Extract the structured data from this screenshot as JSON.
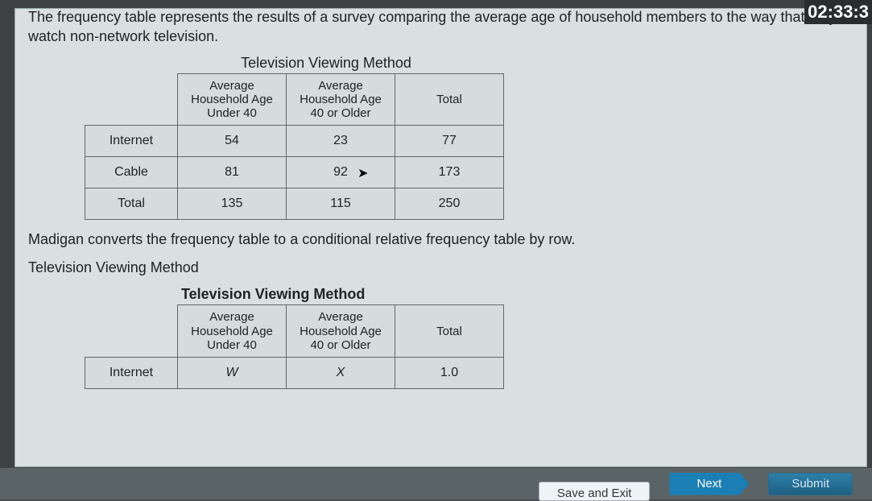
{
  "timer": "02:33:3",
  "intro": "The frequency table represents the results of a survey comparing the average age of household members to the way that they watch non-network television.",
  "table1": {
    "title": "Television Viewing Method",
    "col_headers": [
      "Average Household Age Under 40",
      "Average Household Age 40 or Older",
      "Total"
    ],
    "rows": [
      {
        "label": "Internet",
        "cells": [
          "54",
          "23",
          "77"
        ]
      },
      {
        "label": "Cable",
        "cells": [
          "81",
          "92",
          "173"
        ]
      },
      {
        "label": "Total",
        "cells": [
          "135",
          "115",
          "250"
        ]
      }
    ]
  },
  "paragraph2": "Madigan converts the frequency table to a conditional relative frequency table by row.",
  "subtitle2": "Television Viewing Method",
  "table2": {
    "title": "Television Viewing Method",
    "col_headers": [
      "Average Household Age Under 40",
      "Average Household Age 40 or Older",
      "Total"
    ],
    "rows": [
      {
        "label": "Internet",
        "cells": [
          "W",
          "X",
          "1.0"
        ]
      }
    ]
  },
  "buttons": {
    "save": "Save and Exit",
    "next": "Next",
    "submit": "Submit"
  }
}
